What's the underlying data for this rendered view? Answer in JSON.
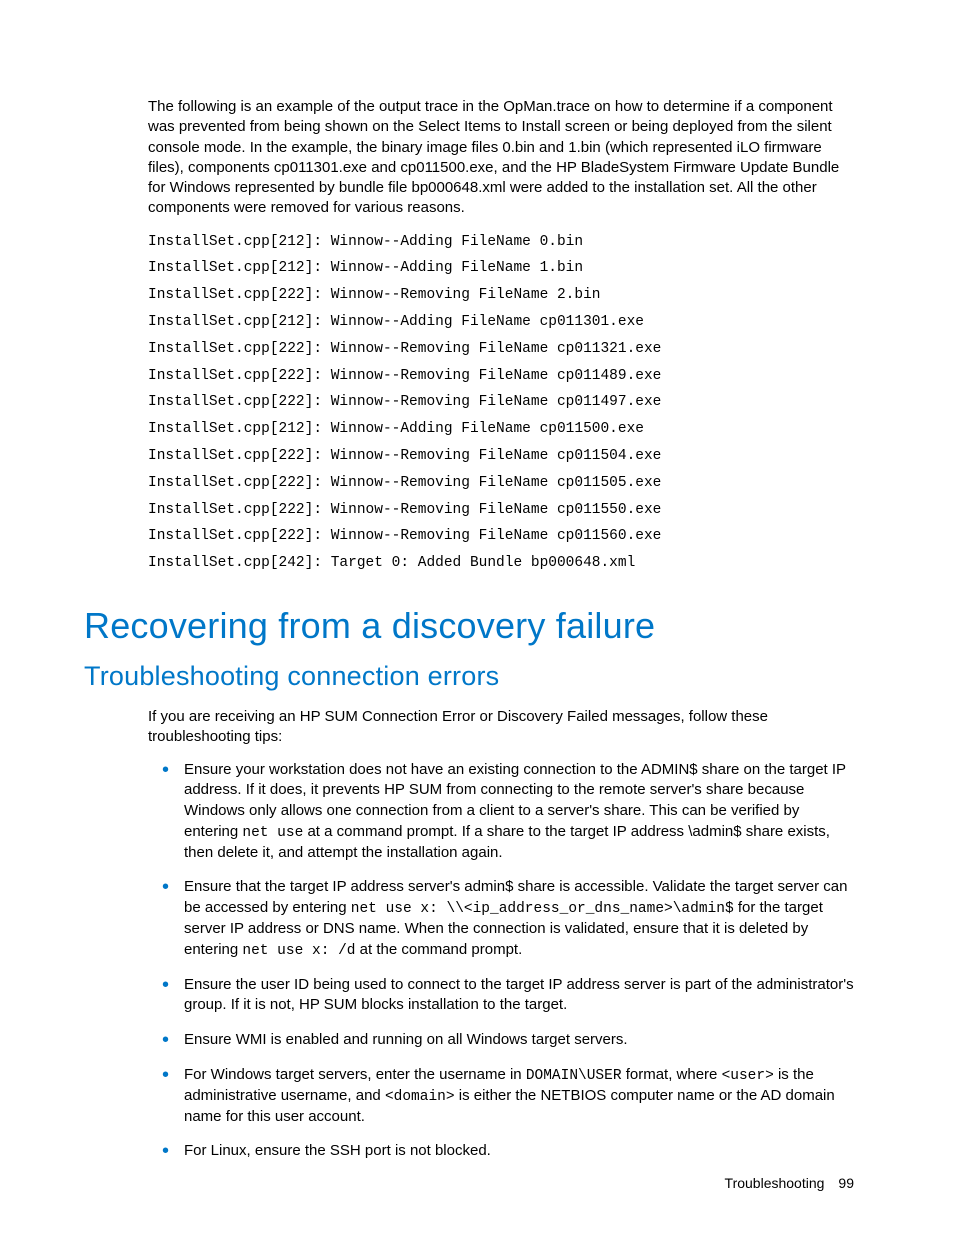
{
  "intro": "The following is an example of the output trace in the OpMan.trace on how to determine if a component was prevented from being shown on the Select Items to Install screen or being deployed from the silent console mode. In the example, the binary image files 0.bin and 1.bin (which represented iLO firmware files), components cp011301.exe and cp011500.exe, and the HP BladeSystem Firmware Update Bundle for Windows represented by bundle file bp000648.xml were added to the installation set.  All the other components were removed for various reasons.",
  "trace_lines": [
    "InstallSet.cpp[212]: Winnow--Adding FileName 0.bin",
    "InstallSet.cpp[212]: Winnow--Adding FileName 1.bin",
    "InstallSet.cpp[222]: Winnow--Removing FileName 2.bin",
    "InstallSet.cpp[212]: Winnow--Adding FileName cp011301.exe",
    "InstallSet.cpp[222]: Winnow--Removing FileName cp011321.exe",
    "InstallSet.cpp[222]: Winnow--Removing FileName cp011489.exe",
    "InstallSet.cpp[222]: Winnow--Removing FileName cp011497.exe",
    "InstallSet.cpp[212]: Winnow--Adding FileName cp011500.exe",
    "InstallSet.cpp[222]: Winnow--Removing FileName cp011504.exe",
    "InstallSet.cpp[222]: Winnow--Removing FileName cp011505.exe",
    "InstallSet.cpp[222]: Winnow--Removing FileName cp011550.exe",
    "InstallSet.cpp[222]: Winnow--Removing FileName cp011560.exe",
    "InstallSet.cpp[242]: Target 0: Added Bundle bp000648.xml"
  ],
  "h1": "Recovering from a discovery failure",
  "h2": "Troubleshooting connection errors",
  "lead": "If you are receiving an HP SUM Connection Error or Discovery Failed messages, follow these troubleshooting tips:",
  "bullets": {
    "b0": {
      "t0": "Ensure your workstation does not have an existing connection to the ADMIN$ share on the target IP address. If it does, it prevents HP SUM from connecting to the remote server's share because Windows only allows one connection from a client to a server's share. This can be verified by entering ",
      "c0": "net use",
      "t1": " at a command prompt. If a share to the target IP address \\admin$ share exists, then delete it, and attempt the installation again."
    },
    "b1": {
      "t0": "Ensure that the target IP address server's admin$ share is accessible. Validate the target server can be accessed by entering ",
      "c0": "net use x: \\\\<ip_address_or_dns_name>\\admin$",
      "t1": " for the target server IP address or DNS name. When the connection is validated, ensure that it is deleted by entering ",
      "c1": "net use x: /d",
      "t2": " at the command prompt."
    },
    "b2": {
      "t0": "Ensure the user ID being used to connect to the target IP address server is part of the administrator's group. If it is not, HP SUM blocks installation to the target."
    },
    "b3": {
      "t0": "Ensure WMI is enabled and running on all Windows target servers."
    },
    "b4": {
      "t0": "For Windows target servers, enter the username in ",
      "c0": "DOMAIN\\USER",
      "t1": " format, where ",
      "c1": "<user>",
      "t2": " is the administrative username, and ",
      "c2": "<domain>",
      "t3": " is either the NETBIOS computer name or the AD domain name for this user account."
    },
    "b5": {
      "t0": "For Linux, ensure the SSH port is not blocked."
    }
  },
  "footer": {
    "section": "Troubleshooting",
    "page": "99"
  }
}
